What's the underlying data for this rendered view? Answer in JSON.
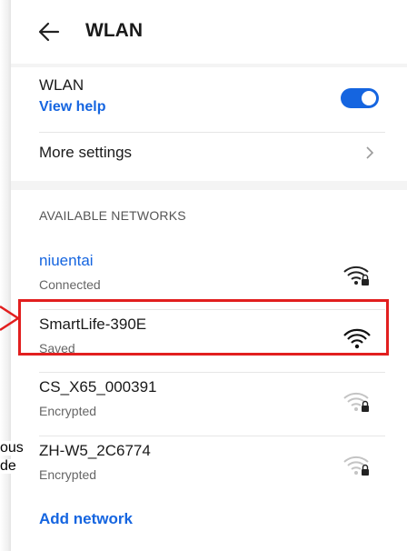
{
  "header": {
    "title": "WLAN"
  },
  "wlan": {
    "label": "WLAN",
    "help_link": "View help",
    "enabled": true
  },
  "more_settings": {
    "label": "More settings"
  },
  "networks_section": {
    "heading": "AVAILABLE NETWORKS"
  },
  "networks": [
    {
      "name": "niuentai",
      "status": "Connected",
      "icon": "wifi-lock-icon"
    },
    {
      "name": "SmartLife-390E",
      "status": "Saved",
      "icon": "wifi-icon"
    },
    {
      "name": "CS_X65_000391",
      "status": "Encrypted",
      "icon": "wifi-lock-icon"
    },
    {
      "name": "ZH-W5_2C6774",
      "status": "Encrypted",
      "icon": "wifi-lock-icon"
    }
  ],
  "add_network": "Add network",
  "left_text_fragments": [
    "ous",
    "de"
  ],
  "colors": {
    "accent": "#1565e0",
    "highlight": "#e21f1f",
    "background": "#f4f4f4"
  }
}
